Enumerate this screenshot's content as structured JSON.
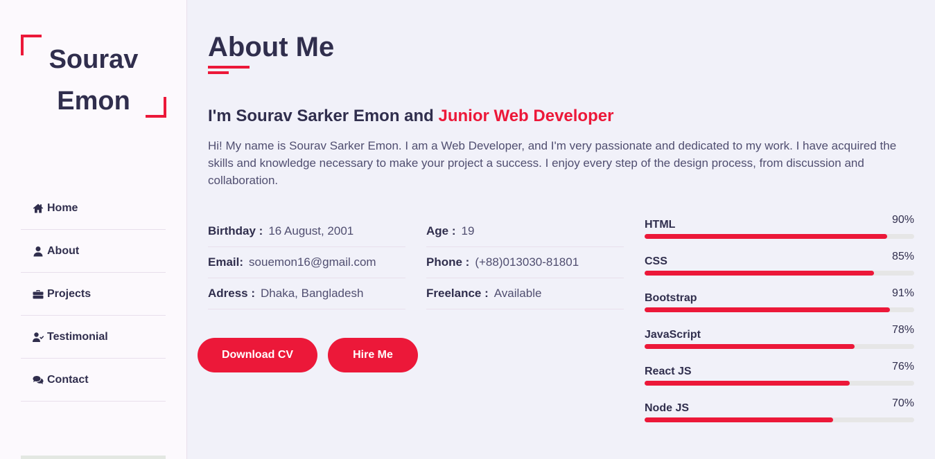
{
  "logo": {
    "line1": "Sourav",
    "line2": "Emon"
  },
  "nav": [
    {
      "label": "Home",
      "icon": "home-icon"
    },
    {
      "label": "About",
      "icon": "user-icon"
    },
    {
      "label": "Projects",
      "icon": "briefcase-icon"
    },
    {
      "label": "Testimonial",
      "icon": "user-check-icon"
    },
    {
      "label": "Contact",
      "icon": "comments-icon"
    }
  ],
  "about": {
    "title": "About Me",
    "intro_prefix": "I'm Sourav Sarker Emon and ",
    "intro_role": "Junior Web Developer",
    "paragraph": "Hi! My name is Sourav Sarker Emon. I am a Web Developer, and I'm very passionate and dedicated to my work. I have acquired the skills and knowledge necessary to make your project a success. I enjoy every step of the design process, from discussion and collaboration."
  },
  "info_left": [
    {
      "key": "Birthday :",
      "value": "16 August, 2001"
    },
    {
      "key": "Email:",
      "value": "souemon16@gmail.com"
    },
    {
      "key": "Adress :",
      "value": "Dhaka, Bangladesh"
    }
  ],
  "info_right": [
    {
      "key": "Age :",
      "value": "19"
    },
    {
      "key": "Phone :",
      "value": "(+88)013030-81801"
    },
    {
      "key": "Freelance :",
      "value": "Available"
    }
  ],
  "buttons": {
    "download": "Download CV",
    "hire": "Hire Me"
  },
  "skills": [
    {
      "name": "HTML",
      "percent_label": "90%",
      "level": 90
    },
    {
      "name": "CSS",
      "percent_label": "85%",
      "level": 85
    },
    {
      "name": "Bootstrap",
      "percent_label": "91%",
      "level": 91
    },
    {
      "name": "JavaScript",
      "percent_label": "78%",
      "level": 78
    },
    {
      "name": "React JS",
      "percent_label": "76%",
      "level": 76
    },
    {
      "name": "Node JS",
      "percent_label": "70%",
      "level": 70
    }
  ],
  "colors": {
    "accent": "#ec1839",
    "text": "#302e4d",
    "background": "#f1f1f9"
  }
}
